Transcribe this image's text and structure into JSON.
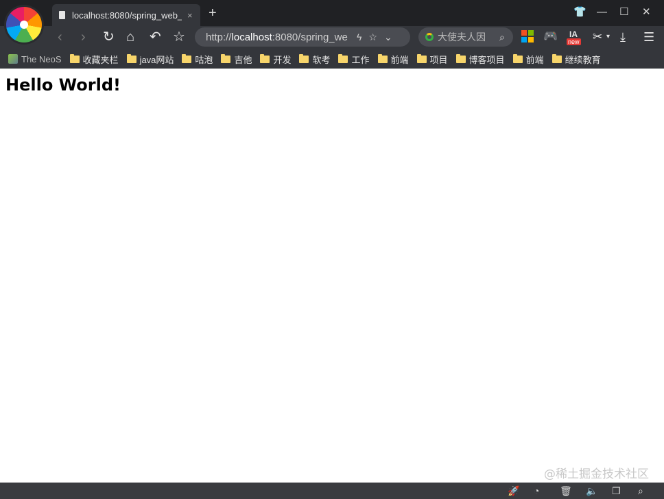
{
  "window": {
    "tab_title": "localhost:8080/spring_web_",
    "tab_close": "×",
    "new_tab": "+"
  },
  "toolbar": {
    "url_scheme": "http://",
    "url_host": "localhost",
    "url_rest": ":8080/spring_we",
    "search_placeholder": "大使夫人因",
    "ext_badge_text": "IA",
    "ext_badge_new": "new"
  },
  "bookmarks": {
    "first": "The NeoS",
    "folders": [
      "收藏夹栏",
      "java网站",
      "咕泡",
      "吉他",
      "开发",
      "软考",
      "工作",
      "前端",
      "项目",
      "博客项目",
      "前端",
      "继续教育"
    ]
  },
  "page": {
    "heading": "Hello World!",
    "watermark": "@稀土掘金技术社区"
  },
  "colors": {
    "chrome_bg": "#34363b",
    "tabstrip_bg": "#202124",
    "folder": "#f7d56b",
    "statusbar_bg": "#3a3b3f"
  },
  "icons": {
    "nav": [
      "back-icon",
      "forward-icon",
      "reload-icon",
      "home-icon",
      "undo-icon",
      "favorite-star-icon"
    ],
    "status": [
      "rocket-icon",
      "speed-icon",
      "trash-icon",
      "speaker-icon",
      "window-icon",
      "search-icon"
    ]
  }
}
